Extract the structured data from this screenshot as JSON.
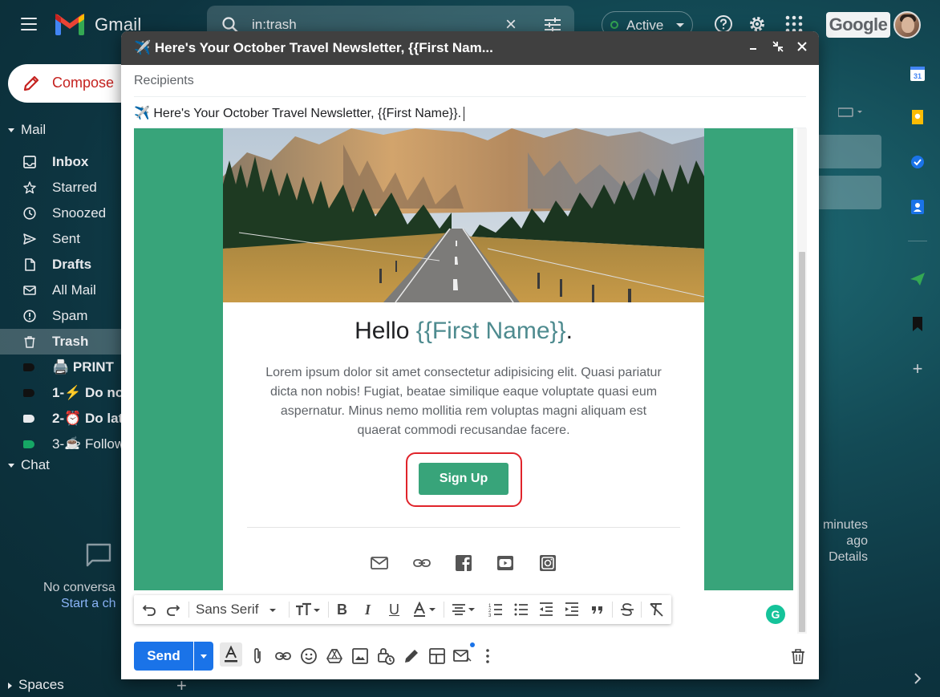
{
  "app": {
    "brand": "Gmail",
    "search_value": "in:trash",
    "status": "Active",
    "google_label": "Google"
  },
  "sidebar": {
    "compose_label": "Compose",
    "mail_heading": "Mail",
    "items": [
      {
        "label": "Inbox",
        "icon": "inbox-icon",
        "bold": true
      },
      {
        "label": "Starred",
        "icon": "star-icon",
        "bold": false
      },
      {
        "label": "Snoozed",
        "icon": "clock-icon",
        "bold": false
      },
      {
        "label": "Sent",
        "icon": "send-icon",
        "bold": false
      },
      {
        "label": "Drafts",
        "icon": "draft-icon",
        "bold": true
      },
      {
        "label": "All Mail",
        "icon": "mail-icon",
        "bold": false
      },
      {
        "label": "Spam",
        "icon": "spam-icon",
        "bold": false
      },
      {
        "label": "Trash",
        "icon": "trash-icon",
        "bold": true,
        "active": true
      },
      {
        "label": "🖨️ PRINT",
        "icon": "label-icon",
        "bold": true
      },
      {
        "label": "1-⚡ Do no",
        "icon": "label-icon",
        "bold": true
      },
      {
        "label": "2-⏰ Do lat",
        "icon": "label-icon",
        "bold": true
      },
      {
        "label": "3-☕ Follow",
        "icon": "label-icon",
        "bold": false
      }
    ],
    "chat_heading": "Chat",
    "no_conversations": "No conversa",
    "start_chat": "Start a ch",
    "spaces_heading": "Spaces"
  },
  "background": {
    "minutes": "minutes",
    "ago": "ago",
    "details": "Details"
  },
  "compose": {
    "title": "✈️ Here's Your October Travel Newsletter, {{First Nam...",
    "recipients_placeholder": "Recipients",
    "subject": "✈️ Here's Your October Travel Newsletter, {{First Name}}.",
    "email": {
      "hello_prefix": "Hello ",
      "hello_name": "{{First Name}}",
      "hello_suffix": ".",
      "body": "Lorem ipsum dolor sit amet consectetur adipisicing elit. Quasi pariatur dicta non nobis! Fugiat, beatae similique eaque voluptate quasi eum aspernatur. Minus nemo mollitia rem voluptas magni aliquam est quaerat commodi recusandae facere.",
      "cta": "Sign Up",
      "social_icons": [
        "mail-icon",
        "link-icon",
        "facebook-icon",
        "youtube-icon",
        "instagram-icon"
      ],
      "accent_color": "#38a47a"
    },
    "toolbar": {
      "font": "Sans Serif"
    },
    "send_label": "Send",
    "send_color": "#1a73e8"
  }
}
